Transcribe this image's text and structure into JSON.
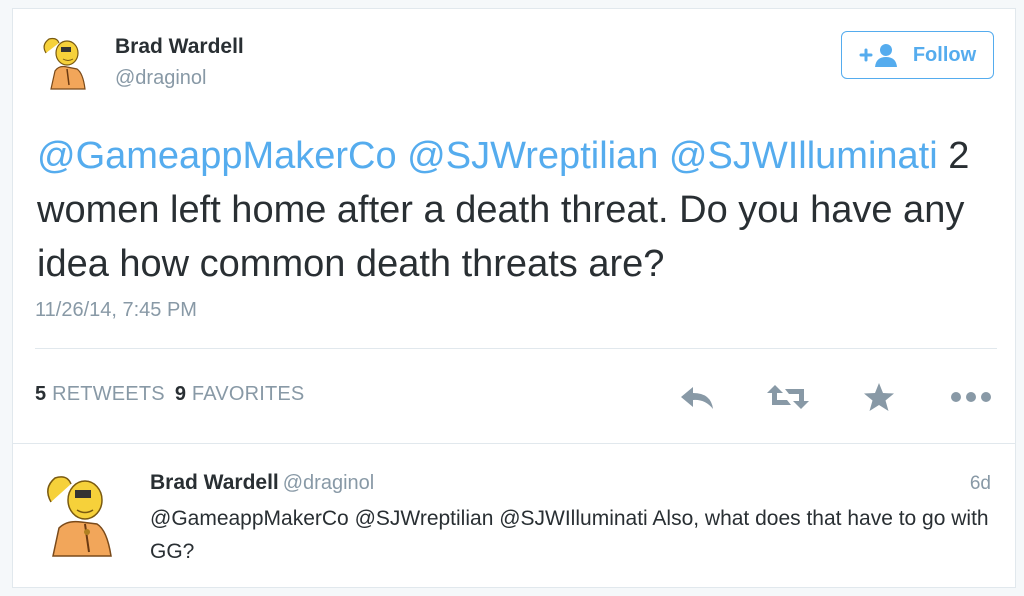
{
  "tweet": {
    "author_name": "Brad Wardell",
    "author_handle": "@draginol",
    "follow_label": "Follow",
    "mentions": [
      "@GameappMakerCo",
      "@SJWreptilian",
      "@SJWIlluminati"
    ],
    "body": "2 women left home after a death threat. Do you have any idea how common death threats are?",
    "timestamp": "11/26/14, 7:45 PM",
    "retweets_count": "5",
    "retweets_label": "RETWEETS",
    "favorites_count": "9",
    "favorites_label": "FAVORITES",
    "actions": [
      "reply-icon",
      "retweet-icon",
      "favorite-icon",
      "more-icon"
    ]
  },
  "reply": {
    "author_name": "Brad Wardell",
    "author_handle": "@draginol",
    "time": "6d",
    "text": "@GameappMakerCo @SJWreptilian @SJWIlluminati Also, what does that have to go with GG?"
  },
  "colors": {
    "accent": "#55acee",
    "text": "#292f33",
    "muted": "#8899a6",
    "icon": "#8899a6",
    "border": "#e1e8ed"
  }
}
